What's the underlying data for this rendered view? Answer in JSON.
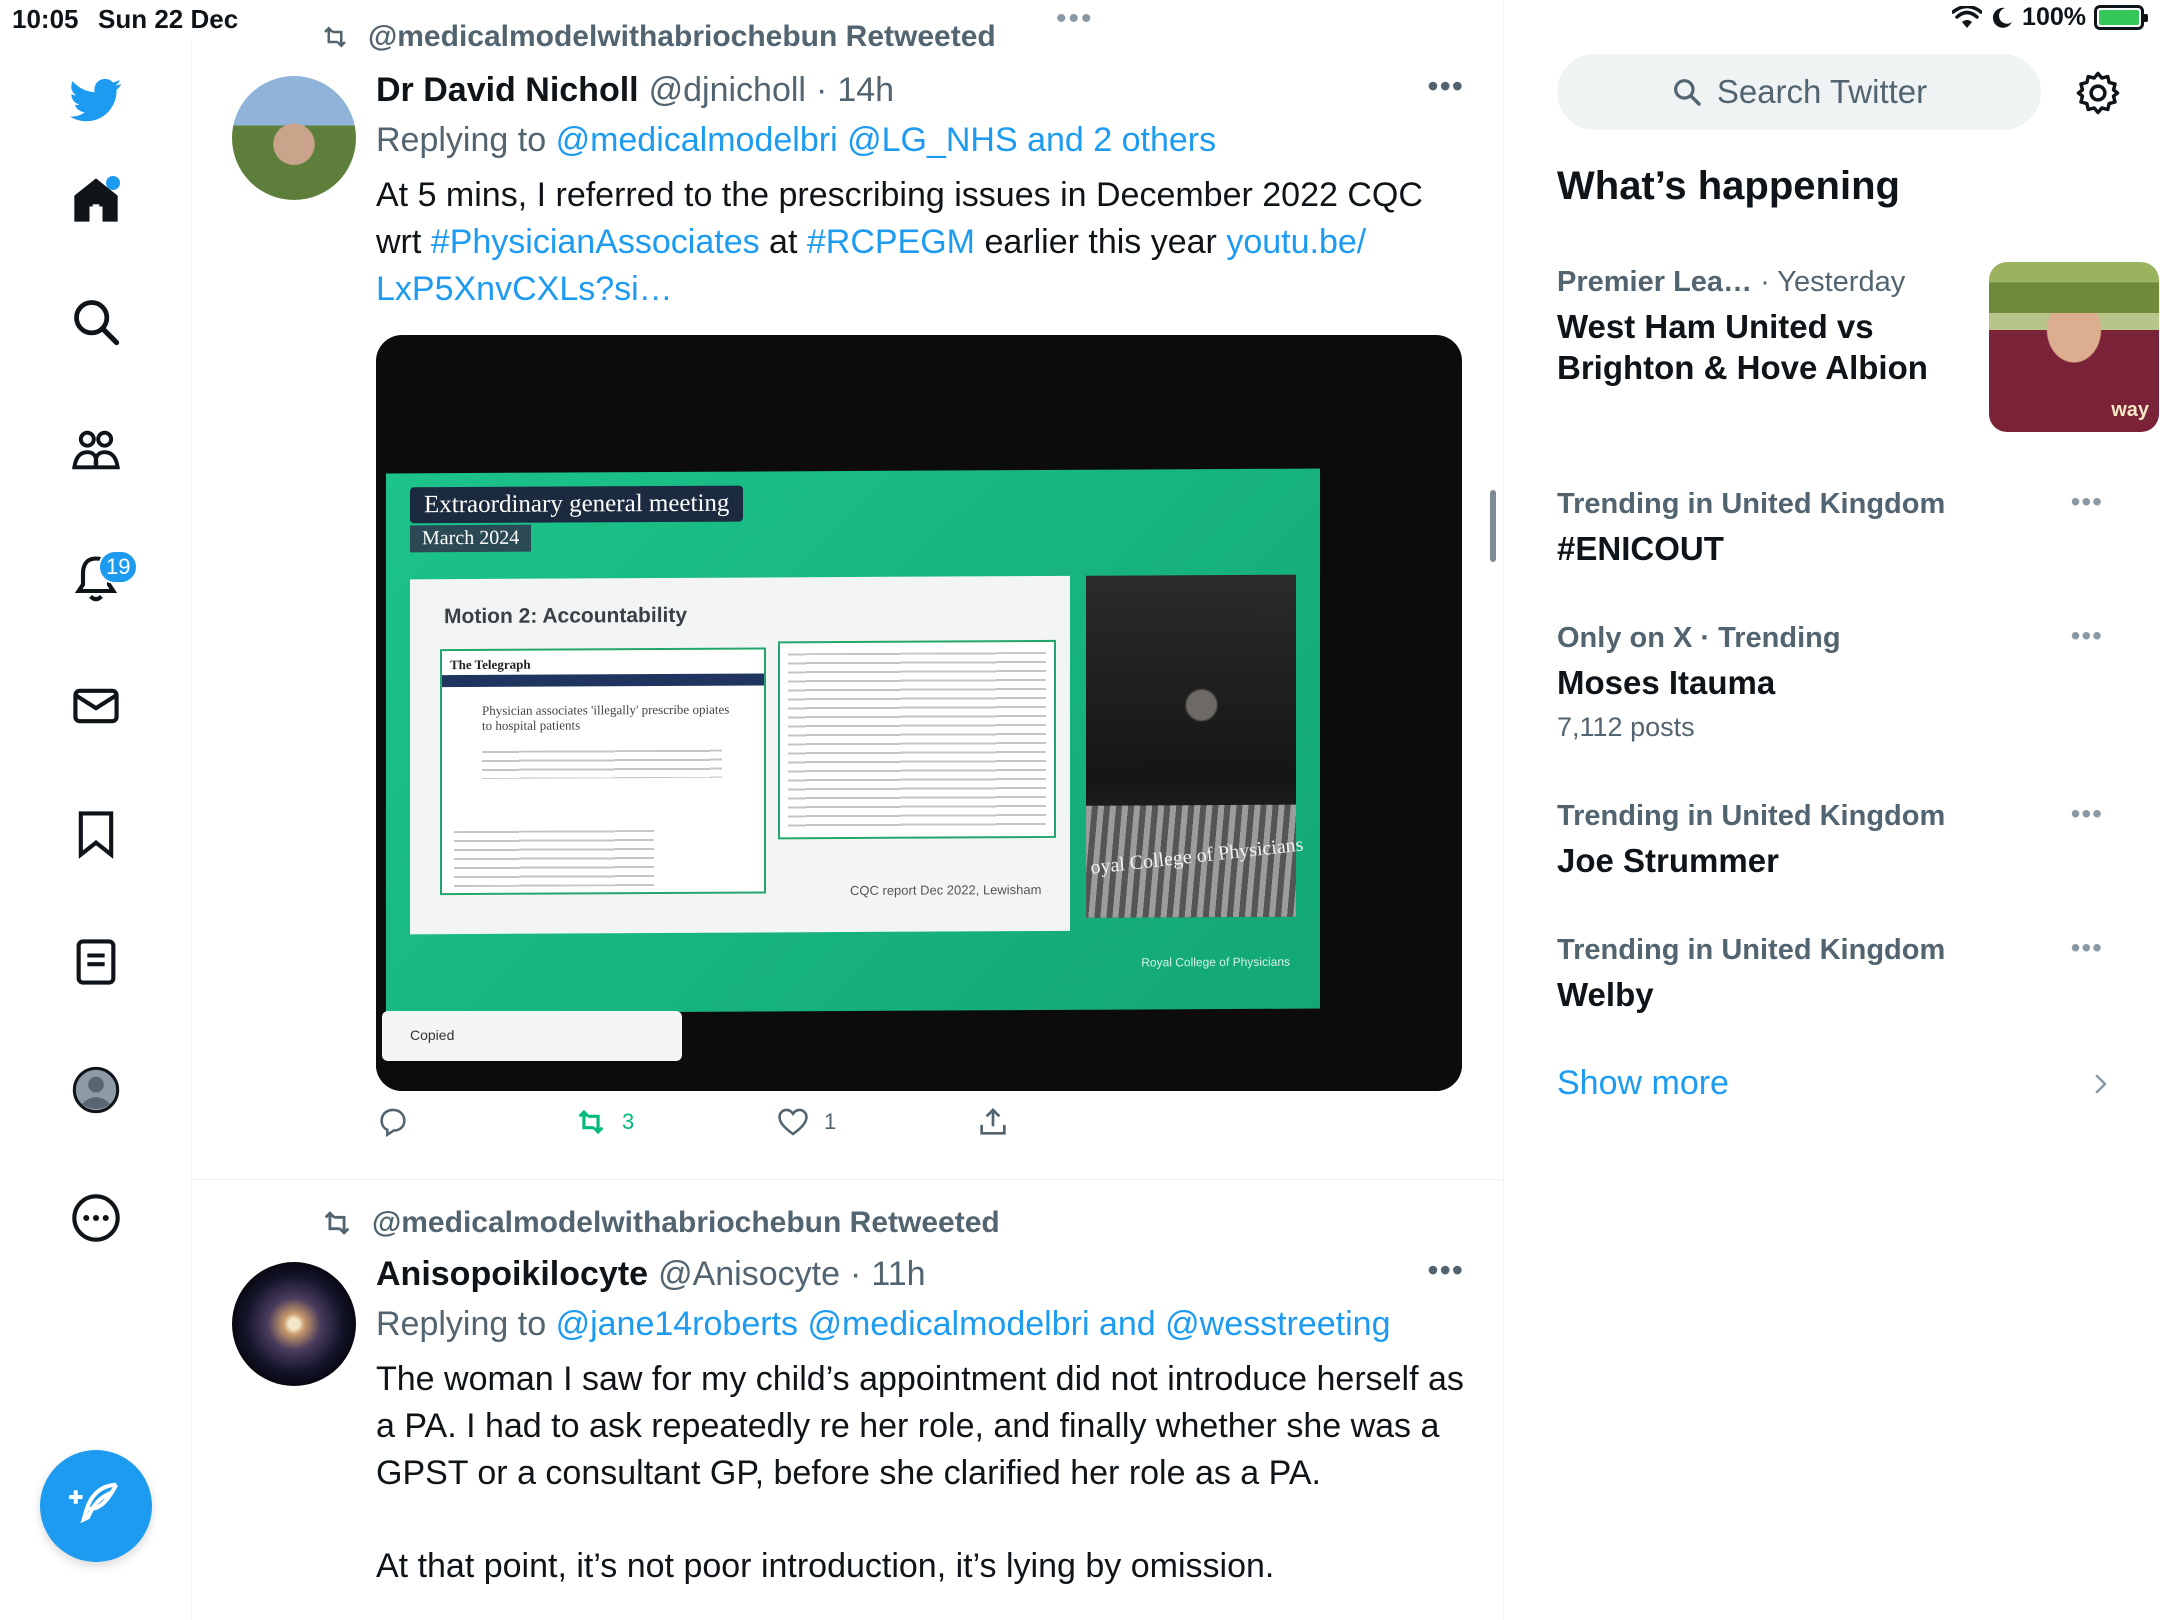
{
  "status_bar": {
    "time": "10:05",
    "date": "Sun 22 Dec",
    "battery": "100%"
  },
  "nav": {
    "notification_count": "19",
    "icons": [
      "twitter-logo-icon",
      "home-icon",
      "search-icon",
      "communities-icon",
      "notifications-icon",
      "messages-icon",
      "bookmarks-icon",
      "lists-icon",
      "profile-icon",
      "more-icon",
      "compose-icon"
    ]
  },
  "tweets": [
    {
      "retweet_label": "@medicalmodelwithabriochebun Retweeted",
      "name": "Dr David Nicholl",
      "handle": "@djnicholl",
      "time": "14h",
      "replying_to_label": "Replying to",
      "replying_to_links": "@medicalmodelbri @LG_NHS and 2 others",
      "text": {
        "part1": "At 5 mins, I referred to the prescribing issues in December 2022 CQC wrt ",
        "hashtag1": "#PhysicianAssociates",
        "part2": " at ",
        "hashtag2": "#RCPEGM",
        "part3": " earlier this year ",
        "link": "youtu.be/ LxP5XnvCXLs?si…"
      },
      "media": {
        "slide_title": "Extraordinary general meeting",
        "slide_date": "March 2024",
        "slide_motion": "Motion 2: Accountability",
        "newspaper_masthead": "The Telegraph",
        "newspaper_headline": "Physician associates 'illegally' prescribe opiates to hospital patients",
        "doc_caption": "CQC report Dec 2022, Lewisham",
        "podium_text": "oyal College of Physicians",
        "logo_text": "Royal College of Physicians",
        "toast": "Copied"
      },
      "stats": {
        "replies": "",
        "retweets": "3",
        "likes": "1"
      }
    },
    {
      "retweet_label": "@medicalmodelwithabriochebun Retweeted",
      "name": "Anisopoikilocyte",
      "handle": "@Anisocyte",
      "time": "11h",
      "replying_to_label": "Replying to",
      "replying_to_links": "@jane14roberts @medicalmodelbri and @wesstreeting",
      "paragraph1": "The woman I saw for my child’s appointment did not introduce herself as a PA. I had to ask repeatedly re her role, and finally whether she was a GPST or a consultant GP, before she clarified her role as a PA.",
      "paragraph2": "At that point, it’s not poor introduction, it’s lying by omission."
    }
  ],
  "sidebar": {
    "search_placeholder": "Search Twitter",
    "section_title": "What’s happening",
    "trends": [
      {
        "meta_category": "Premier Lea…",
        "meta_time": "· Yesterday",
        "topic": "West Ham United vs Brighton & Hove Albion",
        "thumb_text": "way"
      },
      {
        "meta": "Trending in United Kingdom",
        "topic": "#ENICOUT"
      },
      {
        "meta": "Only on X · Trending",
        "topic": "Moses Itauma",
        "count": "7,112 posts"
      },
      {
        "meta": "Trending in United Kingdom",
        "topic": "Joe Strummer"
      },
      {
        "meta": "Trending in United Kingdom",
        "topic": "Welby"
      }
    ],
    "show_more": "Show more"
  },
  "colors": {
    "accent": "#1d9bf0",
    "retweet_green": "#00ba7c",
    "text_primary": "#0f1419",
    "text_secondary": "#536471",
    "slide_green": "#1cc38b"
  }
}
